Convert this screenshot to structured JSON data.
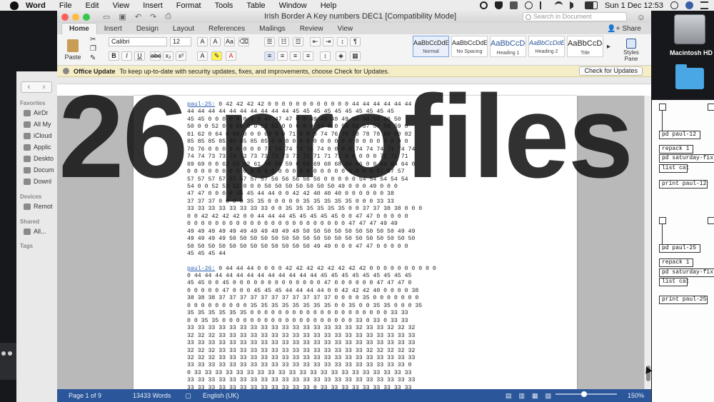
{
  "menubar": {
    "app": "Word",
    "items": [
      "File",
      "Edit",
      "View",
      "Insert",
      "Format",
      "Tools",
      "Table",
      "Window",
      "Help"
    ],
    "datetime": "Sun 1 Dec  12:53"
  },
  "finder": {
    "favorites_header": "Favorites",
    "favorites": [
      "AirDr",
      "All My",
      "iCloud",
      "Applic",
      "Deskto",
      "Docum",
      "Downl"
    ],
    "devices_header": "Devices",
    "devices": [
      "Remot"
    ],
    "shared_header": "Shared",
    "shared": [
      "All..."
    ],
    "tags_header": "Tags"
  },
  "word": {
    "title": "Irish Border A Key numbers DEC1 [Compatibility Mode]",
    "search_placeholder": "Search in Document",
    "tabs": [
      "Home",
      "Insert",
      "Design",
      "Layout",
      "References",
      "Mailings",
      "Review",
      "View"
    ],
    "share": "Share",
    "ribbon": {
      "paste": "Paste",
      "font": "Calibri",
      "size": "12",
      "styles": [
        {
          "preview": "AaBbCcDdEe",
          "name": "Normal"
        },
        {
          "preview": "AaBbCcDdEe",
          "name": "No Spacing"
        },
        {
          "preview": "AaBbCcDc",
          "name": "Heading 1"
        },
        {
          "preview": "AaBbCcDdE",
          "name": "Heading 2"
        },
        {
          "preview": "AaBbCcDc",
          "name": "Title"
        }
      ],
      "styles_pane": "Styles Pane"
    },
    "update": {
      "title": "Office Update",
      "message": "To keep up-to-date with security updates, fixes, and improvements, choose Check for Updates.",
      "button": "Check for Updates"
    },
    "document": {
      "profiles": [
        {
          "name": "paul-25:",
          "lines": [
            " 0 42 42 42 42 0 0 0 0 0 0 0 0 0 0 0 0 44 44 44 44 44 44",
            "44 44 44 44 44 44 44 44 44 44 45 45 45 45 45 45 45 45 45 45",
            "45 45 0 0 0 0 0 0 0 0 47 47 47 0 0 49 49 49 49 50 50 50 50 50",
            "50 0 0 52 0 0 50 0 0 52 52 0 0 0 0 0 54 0 0 56 56 57 57 59 59 0",
            "61 62 0 64 0 66 0 0 0 69 0 0 71 0 0 0 74 76 76 78 78 78 80 80 82",
            "85 85 85 85 85 85 85 85 0 0 0 0 0 0 0 0 0 0 0 0 0 0 0 0 0 0 0 0",
            "76 76 0 0 0 0 0 0 0 0 74 74 74 74 74 74 0 0 0 0 74 74 74 74 74 74",
            "74 74 73 73 73 73 73 73 73 73 71 71 71 71 71 0 0 0 0 0 71 71 71",
            "69 69 0 0 62 62 62 61 59 59 59 0 69 69 68 68 66 66 0 0 64 64 64 0",
            "0 0 0 0 0 0 0 0 0 0 0 0 0 0 0 0 0 0 0 0 0 0 0 0 0 0 0 57 57 57",
            "57 57 57 57 57 57 57 57 56 56 56 56 56 0 0 0 0 0 54 54 54 54 54",
            "54 0 0 52 52 52 0 0 0 50 50 50 50 50 50 50 49 0 0 0 49 0 0 0",
            "47 47 0 0 0 0 45 45 44 44 0 0 42 42 40 40 40 0 0 0 0 0 0 38",
            "37 37 37 0 0 0 0 35 35 0 0 0 0 0 35 35 35 35 35 0 0 0 33 33",
            "33 33 33 33 33 33 33 33 0 0 35 35 35 35 35 35 0 0 37 37 38 38 0 0 0",
            "0 0 42 42 42 42 0 0 44 44 44 45 45 45 45 45 0 0 47 47 0 0 0 0 0",
            "0 0 0 0 0 0 0 0 0 0 0 0 0 0 0 0 0 0 0 0 0 0 0 47 47 47 49 49",
            "49 49 49 49 49 49 49 49 49 49 49 50 50 50 50 50 50 50 50 50 49 49",
            "49 49 49 49 50 50 50 50 50 50 50 50 50 50 50 50 50 50 50 50 50 50",
            "50 50 50 50 50 50 50 50 50 50 50 50 49 49 0 0 0 47 47 0 0 0 0 0",
            "45 45 45 44"
          ]
        },
        {
          "name": "paul-26:",
          "lines": [
            " 0 44 44 44 0 0 0 0 42 42 42 42 42 42 42 42 0 0 0 0 0 0 0 0 0 0",
            "0 44 44 44 44 44 44 44 44 44 44 44 44 45 45 45 45 45 45 45 45 45",
            "45 45 0 0 45 0 0 0 0 0 0 0 0 0 0 0 0 0 47 0 0 0 0 0 0 47 47 47 0",
            "0 0 0 0 0 47 0 0 0 45 45 45 44 44 44 44 0 0 42 42 42 40 0 0 0 0 38",
            "38 38 38 37 37 37 37 37 37 37 37 37 37 37 0 0 0 0 35 0 0 0 0 0 0 0",
            "0 0 0 0 0 0 0 0 0 35 35 35 35 35 35 35 35 0 0 35 0 0 35 35 0 0 0 35",
            "35 35 35 35 35 35 0 0 0 0 0 0 0 0 0 0 0 0 0 0 0 0 0 0 0 0 33 33",
            "0 0 35 35 0 0 0 0 0 0 0 0 0 0 0 0 0 0 0 0 0 0 0 33 0 33 0 33 33",
            "33 33 33 33 33 33 33 33 33 33 33 33 33 33 33 33 32 33 33 32 32 32",
            "32 32 32 33 33 33 33 33 33 33 33 33 33 33 33 33 33 33 33 33 33 33",
            "33 33 33 33 33 33 33 33 33 33 33 33 33 33 33 33 33 33 33 33 33 33",
            "32 32 32 33 33 33 33 33 33 33 33 33 33 33 33 33 33 32 32 32 32 32",
            "32 32 32 33 33 33 33 33 33 33 33 33 33 33 33 33 33 33 33 33 33 33",
            "33 33 33 33 33 33 33 33 33 33 33 33 33 33 33 33 33 33 33 33 33 0",
            "0 33 33 33 33 33 33 33 33 33 33 33 33 33 33 33 33 33 33 33 33 33",
            "33 33 33 33 33 33 33 33 33 33 33 33 33 33 33 33 33 33 33 33 33 33",
            "33 33 33 33 33 33 33 33 33 33 33 33 0 33 33 33 33 33 33 33 33 33",
            "33 33 33 33 33 33 33 33 33 33 33 33 33 33 33 33 33 33 33 33 33 33",
            "33 33 33 33 33 33 33 33 0 0 33 33 33 33 33 33 33 33 33 33 33 33"
          ]
        }
      ]
    },
    "status": {
      "page": "Page 1 of 9",
      "words": "13433 Words",
      "language": "English (UK)",
      "zoom": "150%"
    }
  },
  "desktop": {
    "drive_label": "Macintosh HD"
  },
  "pd": {
    "boxes_top": [
      "pd paul-12",
      "repack 1",
      "pd saturday-fix",
      "list cat",
      "print paul-12"
    ],
    "boxes_bottom": [
      "pd paul-25",
      "repack 1",
      "pd saturday-fix",
      "list cat",
      "print paul-25"
    ]
  },
  "overlay": {
    "caption": "26 profiles"
  }
}
